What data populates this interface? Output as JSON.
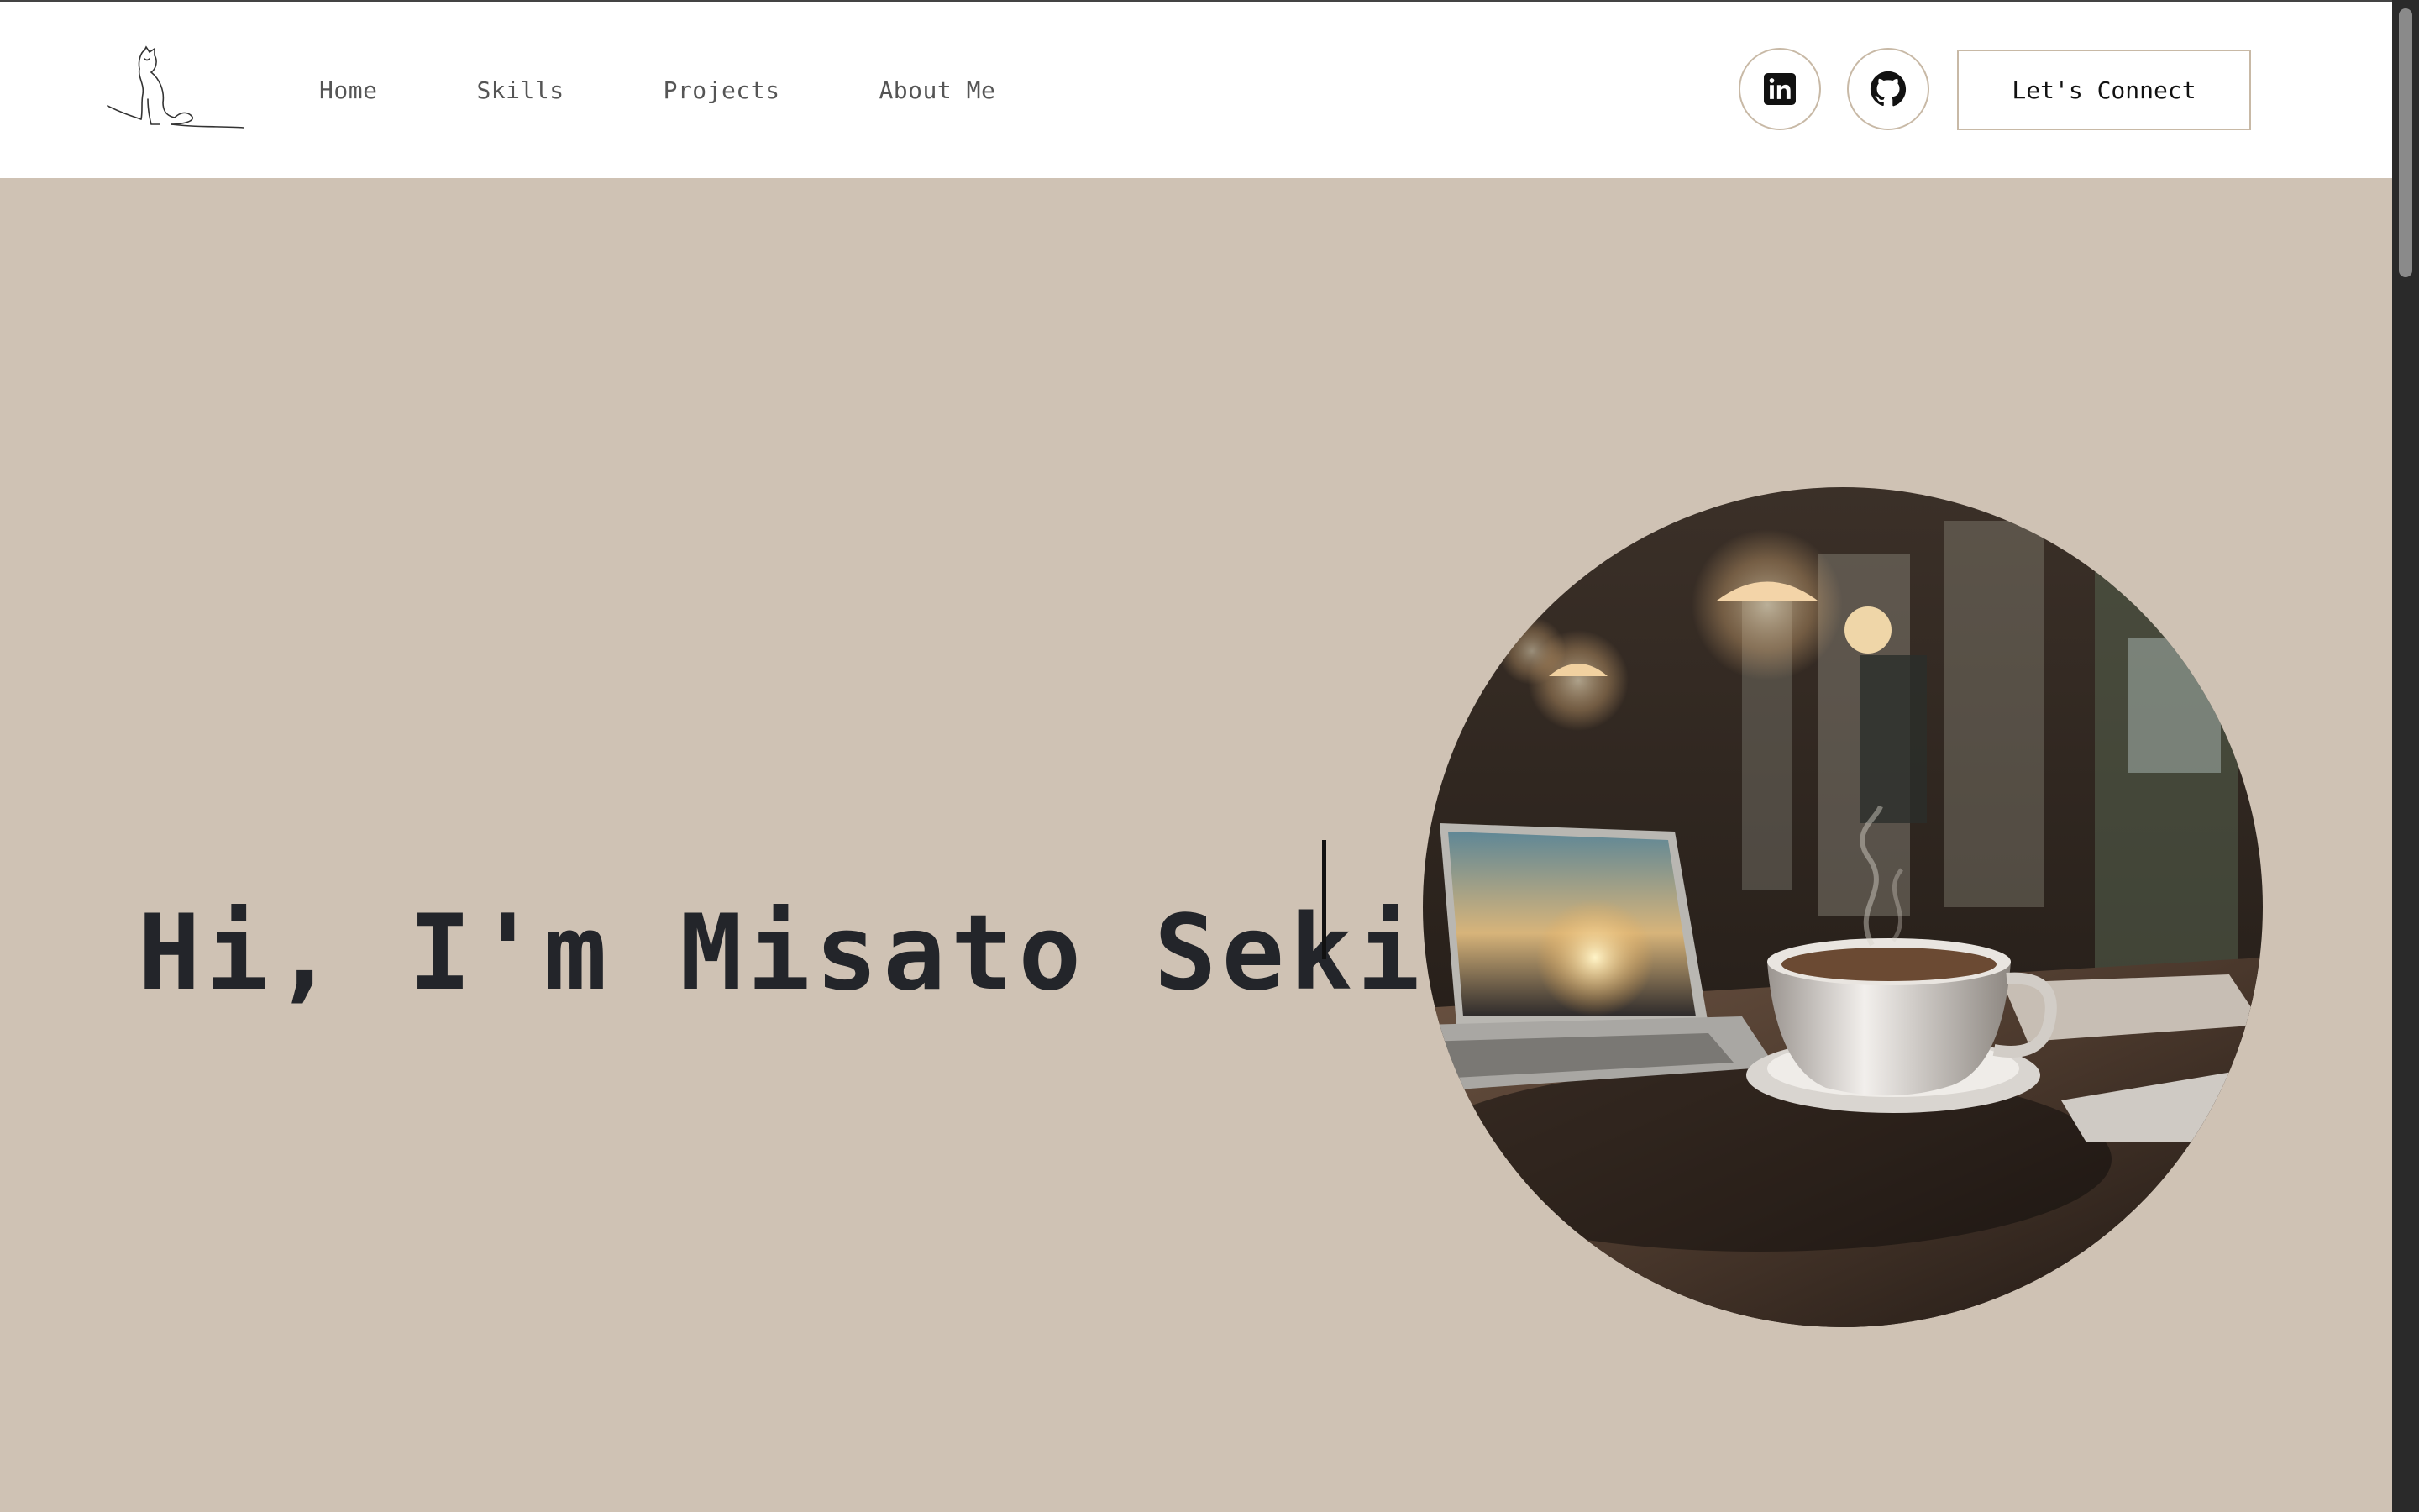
{
  "nav": {
    "logo_icon": "cat-line-drawing-logo",
    "links": [
      {
        "label": "Home"
      },
      {
        "label": "Skills"
      },
      {
        "label": "Projects"
      },
      {
        "label": "About Me"
      }
    ],
    "social": [
      {
        "icon": "linkedin-icon"
      },
      {
        "icon": "github-icon"
      }
    ],
    "cta_label": "Let's Connect"
  },
  "hero": {
    "title": "Hi, I'm Misato Seki.",
    "image_icon": "coffee-cafe-photo"
  },
  "colors": {
    "background": "#cfc2b4",
    "navbar": "#ffffff",
    "text": "#23252a",
    "border": "#c8b9a6"
  }
}
